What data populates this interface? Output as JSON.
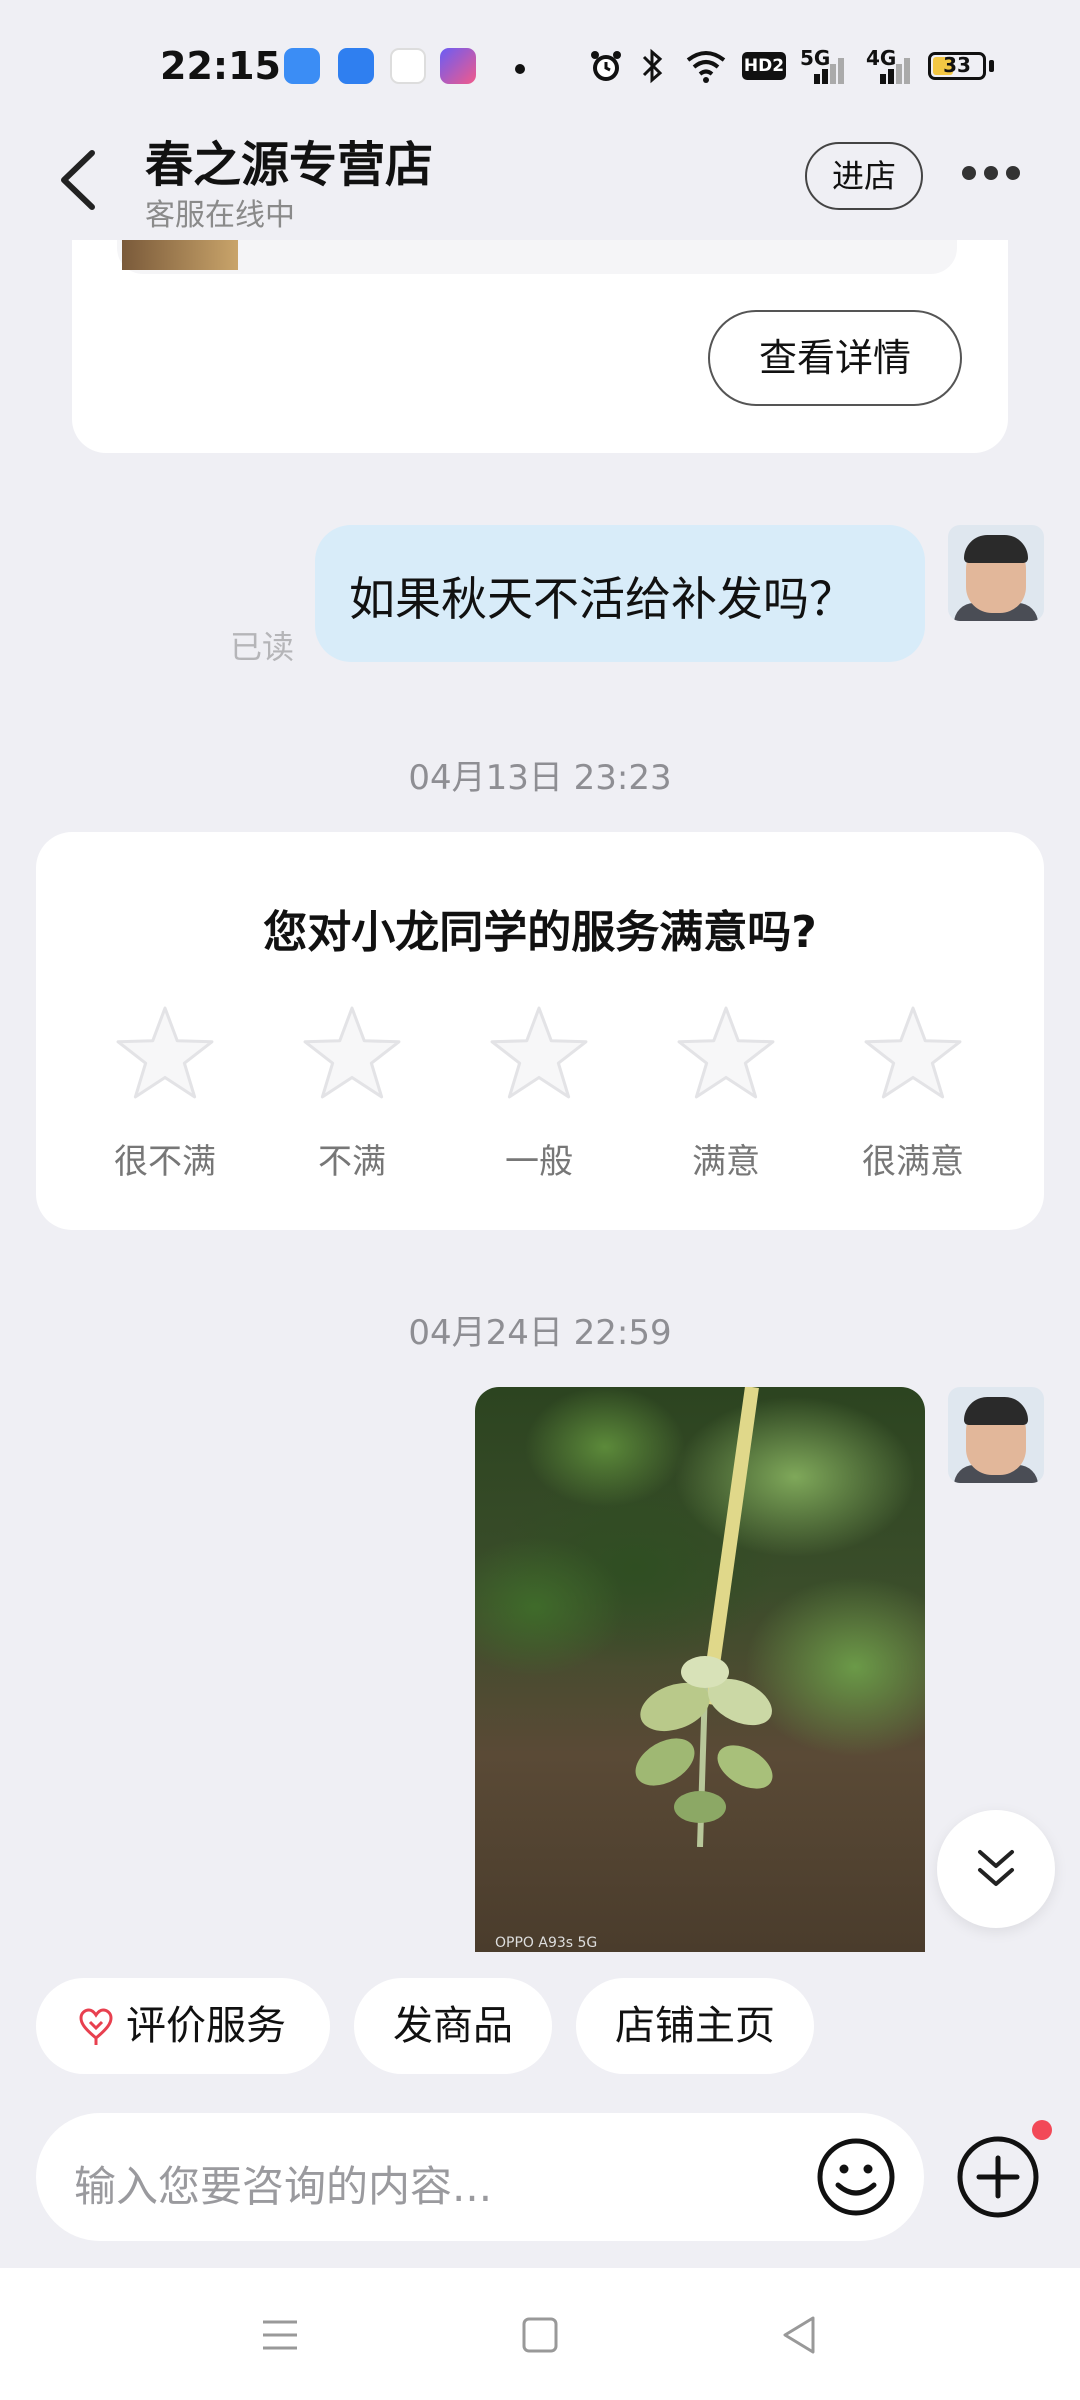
{
  "status_bar": {
    "time": "22:15",
    "network": "5G",
    "network2": "4G",
    "hd": "HD2",
    "battery": "33"
  },
  "header": {
    "shop_name": "春之源专营店",
    "status": "客服在线中",
    "enter_label": "进店"
  },
  "product_card": {
    "details_label": "查看详情"
  },
  "messages": {
    "outgoing_text": "如果秋天不活给补发吗？",
    "read_label": "已读",
    "timestamp_1": "04月13日 23:23",
    "timestamp_2": "04月24日 22:59",
    "photo_watermark": "OPPO A93s 5G"
  },
  "rating": {
    "question": "您对小龙同学的服务满意吗?",
    "options": [
      "很不满",
      "不满",
      "一般",
      "满意",
      "很满意"
    ]
  },
  "quick_actions": {
    "rate_service": "评价服务",
    "send_product": "发商品",
    "shop_home": "店铺主页"
  },
  "input": {
    "placeholder": "输入您要咨询的内容..."
  },
  "colors": {
    "accent_bubble": "#d8ecf9",
    "background": "#efeff4",
    "badge_red": "#f24957",
    "rate_icon": "#e8404f"
  }
}
